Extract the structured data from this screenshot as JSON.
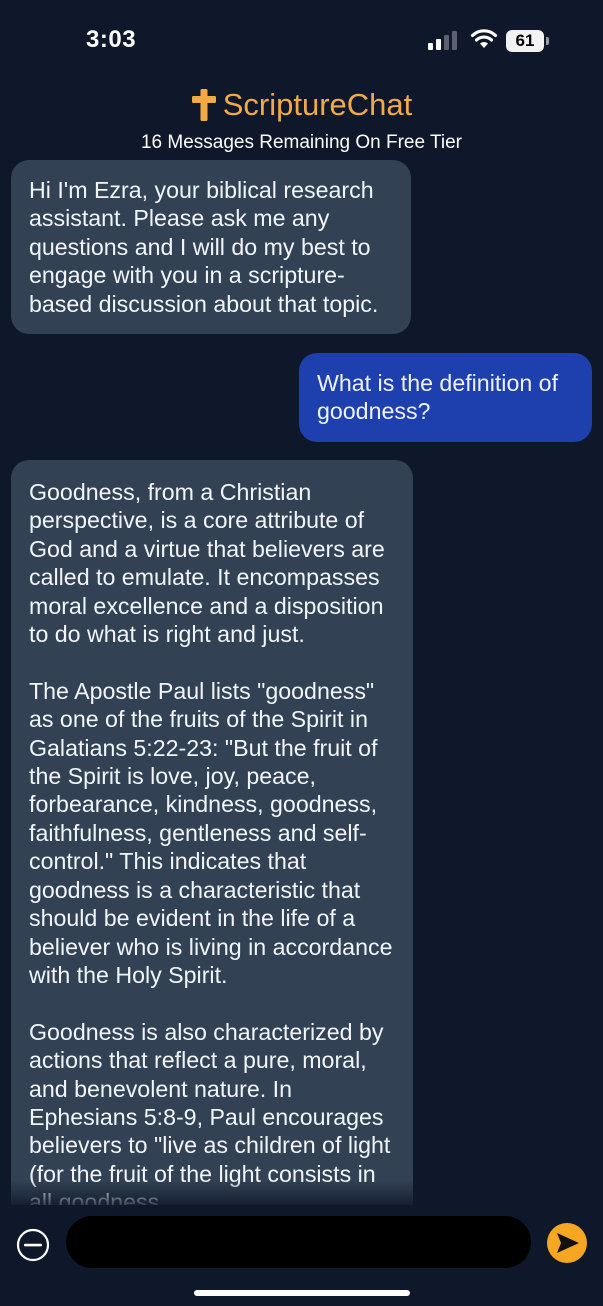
{
  "status_bar": {
    "time": "3:03",
    "battery_level": "61",
    "signal_icon": "cellular-signal-icon",
    "wifi_icon": "wifi-icon"
  },
  "header": {
    "app_name": "ScriptureChat",
    "logo_icon": "cross-icon",
    "subtitle": "16 Messages Remaining On Free Tier"
  },
  "messages": [
    {
      "role": "assistant",
      "text": "Hi I'm Ezra, your biblical research assistant. Please ask me any questions and I will do my best to engage with you in a scripture-based discussion about that topic."
    },
    {
      "role": "user",
      "text": "What is the definition of goodness?"
    },
    {
      "role": "assistant",
      "text": "Goodness, from a Christian perspective, is a core attribute of God and a virtue that believers are called to emulate. It encompasses moral excellence and a disposition to do what is right and just.\n\nThe Apostle Paul lists \"goodness\" as one of the fruits of the Spirit in Galatians 5:22-23: \"But the fruit of the Spirit is love, joy, peace, forbearance, kindness, goodness, faithfulness, gentleness and self-control.\" This indicates that goodness is a characteristic that should be evident in the life of a believer who is living in accordance with the Holy Spirit.\n\nGoodness is also characterized by actions that reflect a pure, moral, and benevolent nature. In Ephesians 5:8-9, Paul encourages believers to \"live as children of light (for the fruit of the light consists in all goodness,"
    }
  ],
  "input": {
    "placeholder": "",
    "clear_icon": "minus-circle-icon",
    "send_icon": "send-arrow-icon"
  },
  "colors": {
    "background": "#0f172a",
    "assistant_bubble": "#334155",
    "user_bubble": "#1e40af",
    "accent": "#f4a947"
  }
}
